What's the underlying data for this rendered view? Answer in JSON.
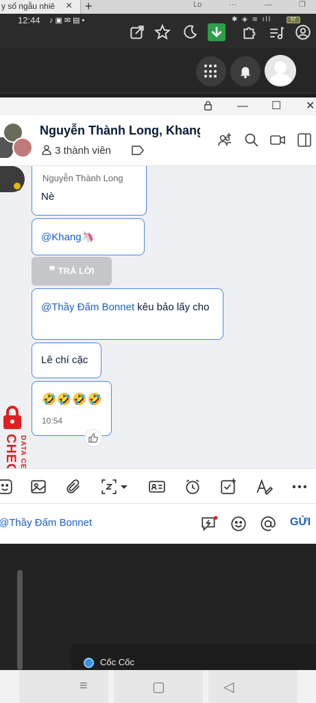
{
  "browser": {
    "tab_title": "y số ngẫu nhiê",
    "close_tab": "×",
    "new_tab": "+",
    "partial_tab": "Lo"
  },
  "status": {
    "time": "12:44",
    "battery": "57"
  },
  "chat": {
    "title": "Nguyễn Thành Long, Khang",
    "members_label": "3 thành viên",
    "messages": [
      {
        "sender": "Nguyễn Thành Long",
        "text": "Nè"
      },
      {
        "text": "@Khang🦄"
      },
      {
        "mention": "@Thầy Đấm Bonnet",
        "text": "kêu bảo lấy cho"
      },
      {
        "text": "Lê chí cặc"
      },
      {
        "text": "🤣🤣🤣🤣",
        "time": "10:54"
      }
    ],
    "reply_button": "TRẢ LỜI",
    "input_value": "@Thầy Đấm Bonnet",
    "send_label": "GỬI"
  },
  "watermark": {
    "main": "CHECKSCAM.INFO",
    "sub": "DATA CENTER"
  },
  "taskbar": {
    "app_label": "Cốc Cốc"
  },
  "colors": {
    "accent": "#1a5fc8",
    "bubble_border": "#4a86e8",
    "watermark": "#e02020"
  }
}
